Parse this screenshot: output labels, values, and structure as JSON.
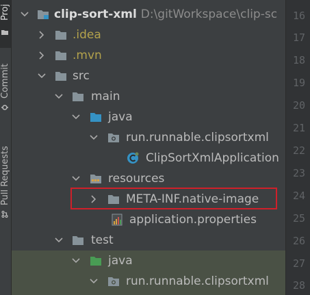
{
  "colors": {
    "panel_bg": "#3c3f41",
    "gutter_bg": "#313335",
    "text": "#bbbbbb",
    "excluded_folder_text": "#b3a24c",
    "highlight_border": "#d0202a",
    "source_folder_blue": "#3592c4",
    "test_folder_green": "#499c54"
  },
  "tool_strip": {
    "tabs": [
      {
        "label": "Proj",
        "icon": "folder-icon"
      },
      {
        "label": "Commit",
        "icon": "commit-icon"
      },
      {
        "label": "Pull Requests",
        "icon": "pull-request-icon"
      }
    ]
  },
  "tree": {
    "rows": [
      {
        "label": "clip-sort-xml",
        "path_hint": "D:\\gitWorkspace\\clip-sc",
        "icon": "module-folder-icon",
        "expanded": true
      },
      {
        "label": ".idea",
        "icon": "folder-icon",
        "expanded": false
      },
      {
        "label": ".mvn",
        "icon": "folder-icon",
        "expanded": false
      },
      {
        "label": "src",
        "icon": "folder-icon",
        "expanded": true
      },
      {
        "label": "main",
        "icon": "folder-icon",
        "expanded": true
      },
      {
        "label": "java",
        "icon": "source-folder-icon",
        "expanded": true
      },
      {
        "label": "run.runnable.clipsortxml",
        "icon": "package-icon",
        "expanded": true
      },
      {
        "label": "ClipSortXmlApplication",
        "icon": "spring-class-icon"
      },
      {
        "label": "resources",
        "icon": "resources-folder-icon",
        "expanded": true
      },
      {
        "label": "META-INF.native-image",
        "icon": "folder-icon",
        "expanded": false
      },
      {
        "label": "application.properties",
        "icon": "properties-file-icon"
      },
      {
        "label": "test",
        "icon": "folder-icon",
        "expanded": true
      },
      {
        "label": "java",
        "icon": "test-source-folder-icon",
        "expanded": true
      },
      {
        "label": "run.runnable.clipsortxml",
        "icon": "package-icon",
        "expanded": true
      }
    ]
  },
  "gutter": {
    "line_numbers": [
      "16",
      "17",
      "18",
      "19",
      "20",
      "21",
      "22",
      "23",
      "24",
      "25",
      "26",
      "27",
      "28"
    ]
  }
}
